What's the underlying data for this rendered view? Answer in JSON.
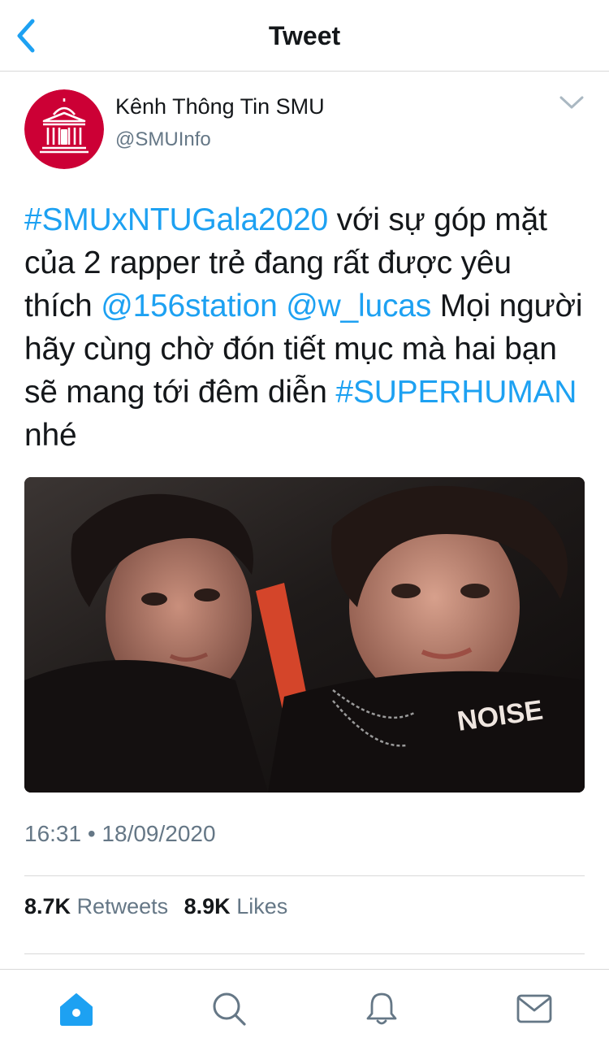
{
  "nav": {
    "title": "Tweet",
    "back_icon": "chevron-left-icon"
  },
  "author": {
    "display_name": "Kênh Thông Tin SMU",
    "handle": "@SMUInfo",
    "avatar_icon": "university-building-icon",
    "avatar_color": "#cc0035"
  },
  "tweet": {
    "segments": [
      {
        "text": "#SMUxNTUGala2020",
        "link": true
      },
      {
        "text": " với sự góp mặt của 2 rapper trẻ đang rất được yêu thích ",
        "link": false
      },
      {
        "text": "@156station",
        "link": true
      },
      {
        "text": " ",
        "link": false
      },
      {
        "text": "@w_lucas",
        "link": true
      },
      {
        "text": " Mọi người hãy cùng chờ đón tiết mục mà hai bạn sẽ mang tới đêm diễn ",
        "link": false
      },
      {
        "text": "#SUPERHUMAN",
        "link": true
      },
      {
        "text": " nhé",
        "link": false
      }
    ],
    "photo_text": "NOISE",
    "timestamp": "16:31 • 18/09/2020"
  },
  "stats": {
    "retweets_count": "8.7K",
    "retweets_label": "Retweets",
    "likes_count": "8.9K",
    "likes_label": "Likes"
  },
  "tabbar": {
    "items": [
      "home-icon",
      "search-icon",
      "notifications-bell-icon",
      "messages-envelope-icon"
    ],
    "active": "home-icon"
  },
  "colors": {
    "link": "#1da1f2",
    "text": "#14171a",
    "muted": "#657786",
    "brand": "#cc0035"
  }
}
